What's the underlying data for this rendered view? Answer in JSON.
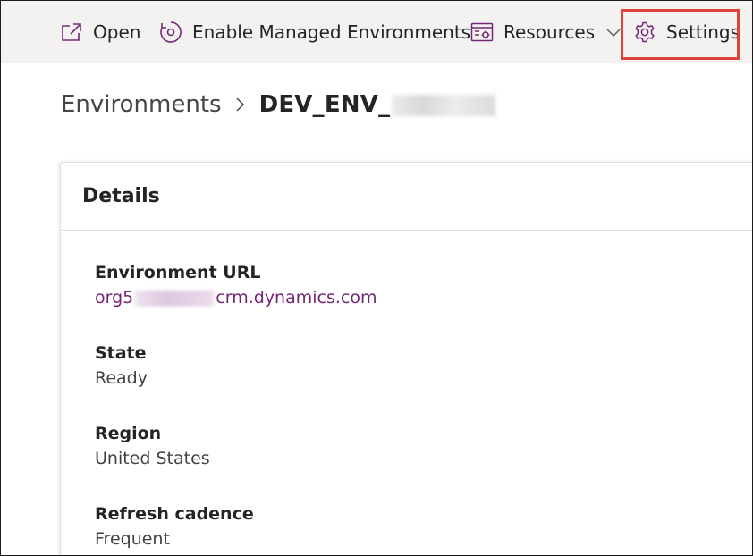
{
  "toolbar": {
    "open_label": "Open",
    "enable_label": "Enable Managed Environments",
    "resources_label": "Resources",
    "settings_label": "Settings"
  },
  "icons": {
    "open": "open-in-new-icon",
    "enable": "managed-environment-icon",
    "resources": "resources-icon",
    "chevron": "chevron-down-icon",
    "settings": "gear-icon",
    "breadcrumb_separator": "chevron-right-icon"
  },
  "colors": {
    "accent": "#742774",
    "highlight_box": "#e0413b",
    "toolbar_bg": "#f3f2f1"
  },
  "breadcrumb": {
    "parent": "Environments",
    "current": "DEV_ENV_"
  },
  "details": {
    "title": "Details",
    "fields": [
      {
        "label": "Environment URL",
        "value_prefix": "org5",
        "value_suffix": "crm.dynamics.com"
      },
      {
        "label": "State",
        "value": "Ready"
      },
      {
        "label": "Region",
        "value": "United States"
      },
      {
        "label": "Refresh cadence",
        "value": "Frequent"
      }
    ]
  }
}
